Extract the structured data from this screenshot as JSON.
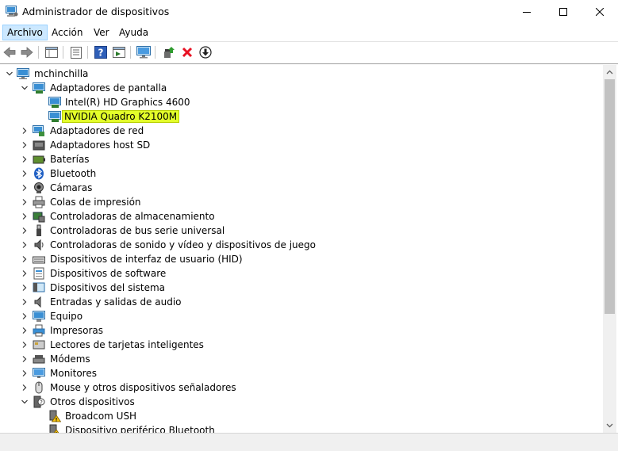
{
  "window": {
    "title": "Administrador de dispositivos"
  },
  "menu": [
    {
      "label": "Archivo",
      "active": true
    },
    {
      "label": "Acción"
    },
    {
      "label": "Ver"
    },
    {
      "label": "Ayuda"
    }
  ],
  "toolbar": {
    "icons": [
      "back-icon",
      "forward-icon",
      "properties-sheet-icon",
      "list-view-icon",
      "help-icon",
      "action-pane-icon",
      "computer-monitor-icon",
      "update-driver-icon",
      "uninstall-icon",
      "download-icon"
    ]
  },
  "tree": {
    "root": "mchinchilla",
    "items": [
      {
        "label": "Adaptadores de pantalla",
        "level": 1,
        "expanded": true,
        "icon": "display-adapter-icon"
      },
      {
        "label": "Intel(R) HD Graphics 4600",
        "level": 2,
        "icon": "display-adapter-icon"
      },
      {
        "label": "NVIDIA Quadro K2100M",
        "level": 2,
        "icon": "display-adapter-icon",
        "highlighted": true
      },
      {
        "label": "Adaptadores de red",
        "level": 1,
        "icon": "network-icon"
      },
      {
        "label": "Adaptadores host SD",
        "level": 1,
        "icon": "sd-host-icon"
      },
      {
        "label": "Baterías",
        "level": 1,
        "icon": "battery-icon"
      },
      {
        "label": "Bluetooth",
        "level": 1,
        "icon": "bluetooth-icon"
      },
      {
        "label": "Cámaras",
        "level": 1,
        "icon": "camera-icon"
      },
      {
        "label": "Colas de impresión",
        "level": 1,
        "icon": "print-queue-icon"
      },
      {
        "label": "Controladoras de almacenamiento",
        "level": 1,
        "icon": "storage-controller-icon"
      },
      {
        "label": "Controladoras de bus serie universal",
        "level": 1,
        "icon": "usb-icon"
      },
      {
        "label": "Controladoras de sonido y vídeo y dispositivos de juego",
        "level": 1,
        "icon": "sound-icon"
      },
      {
        "label": "Dispositivos de interfaz de usuario (HID)",
        "level": 1,
        "icon": "hid-icon"
      },
      {
        "label": "Dispositivos de software",
        "level": 1,
        "icon": "software-device-icon"
      },
      {
        "label": "Dispositivos del sistema",
        "level": 1,
        "icon": "system-device-icon"
      },
      {
        "label": "Entradas y salidas de audio",
        "level": 1,
        "icon": "audio-io-icon"
      },
      {
        "label": "Equipo",
        "level": 1,
        "icon": "computer-icon"
      },
      {
        "label": "Impresoras",
        "level": 1,
        "icon": "printer-icon"
      },
      {
        "label": "Lectores de tarjetas inteligentes",
        "level": 1,
        "icon": "smart-card-icon"
      },
      {
        "label": "Módems",
        "level": 1,
        "icon": "modem-icon"
      },
      {
        "label": "Monitores",
        "level": 1,
        "icon": "monitor-icon"
      },
      {
        "label": "Mouse y otros dispositivos señaladores",
        "level": 1,
        "icon": "mouse-icon"
      },
      {
        "label": "Otros dispositivos",
        "level": 1,
        "expanded": true,
        "icon": "other-devices-icon"
      },
      {
        "label": "Broadcom USH",
        "level": 2,
        "icon": "unknown-device-warning-icon"
      },
      {
        "label": "Dispositivo periférico Bluetooth",
        "level": 2,
        "icon": "unknown-device-warning-icon"
      }
    ]
  },
  "colors": {
    "highlight": "#e3ff2a",
    "menu_active": "#cce8ff",
    "uninstall_red": "#e81123"
  }
}
